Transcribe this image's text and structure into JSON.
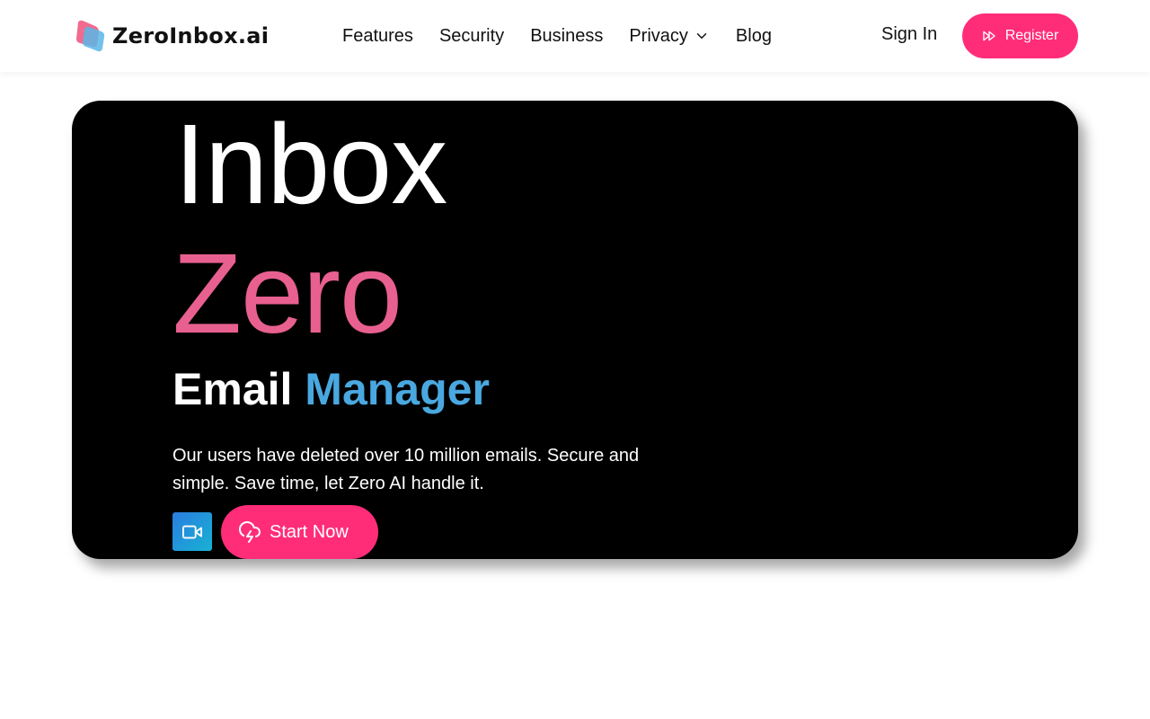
{
  "brand": {
    "name": "ZeroInbox.ai"
  },
  "nav": {
    "items": [
      {
        "label": "Features"
      },
      {
        "label": "Security"
      },
      {
        "label": "Business"
      },
      {
        "label": "Privacy",
        "has_dropdown": true
      },
      {
        "label": "Blog"
      }
    ],
    "signin_label": "Sign In",
    "register_label": "Register"
  },
  "hero": {
    "line1": "Inbox",
    "line2": "Zero",
    "line3_plain": "Email ",
    "line3_accent": "Manager",
    "description": "Our users have deleted over 10 million emails. Secure and simple. Save time, let Zero AI handle it.",
    "cta_label": "Start Now"
  },
  "icons": {
    "register": "fast-forward-icon",
    "video": "video-camera-icon",
    "cta": "cloud-lightning-icon",
    "dropdown": "chevron-down-icon"
  },
  "colors": {
    "accent_pink": "#ff2d78",
    "zero_pink": "#e8608f",
    "manager_blue": "#4aa8e0",
    "hero_bg": "#000000"
  }
}
